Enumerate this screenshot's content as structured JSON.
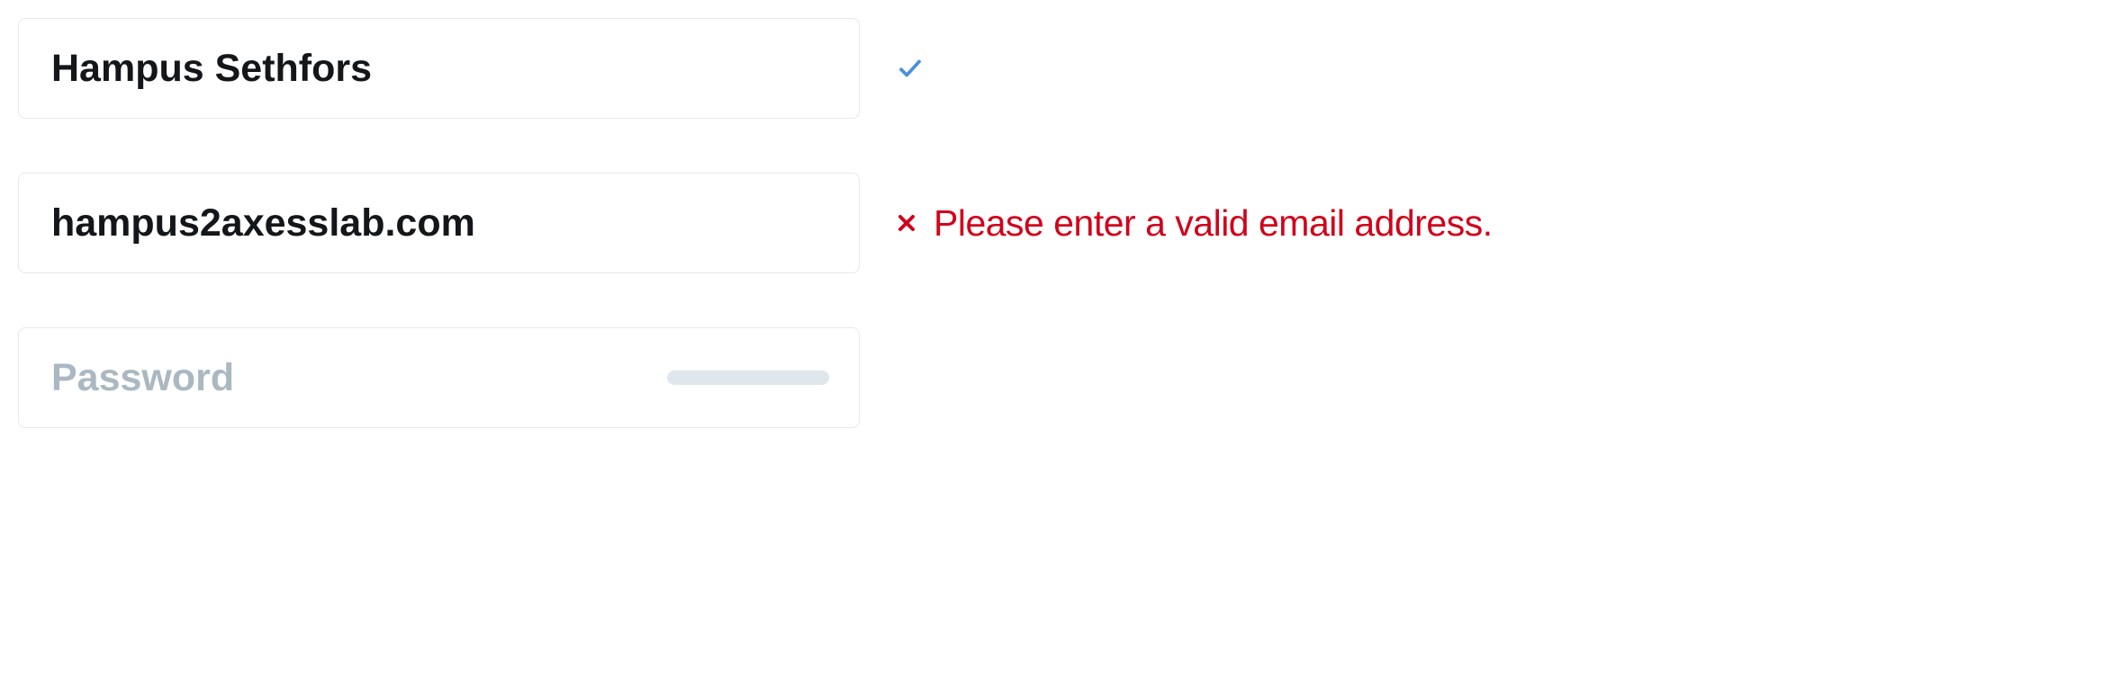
{
  "form": {
    "name": {
      "value": "Hampus Sethfors",
      "status": "valid"
    },
    "email": {
      "value": "hampus2axesslab.com",
      "status": "invalid",
      "error_message": "Please enter a valid email address."
    },
    "password": {
      "value": "",
      "placeholder": "Password"
    }
  },
  "colors": {
    "valid": "#4a90d9",
    "invalid": "#d0021b",
    "placeholder": "#aab8c2",
    "border": "#e8e8e8"
  }
}
